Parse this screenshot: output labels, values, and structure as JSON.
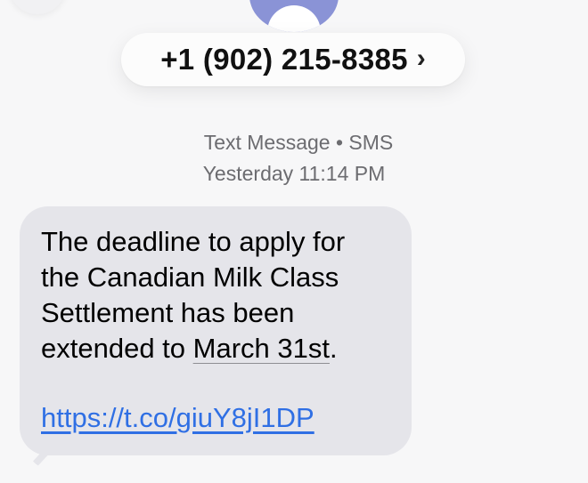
{
  "header": {
    "contact_name": "+1 (902) 215-8385",
    "chevron": "›"
  },
  "meta": {
    "channel": "Text Message • SMS",
    "timestamp": "Yesterday 11:14 PM"
  },
  "message": {
    "line1": "The deadline to apply for",
    "line2": "the Canadian Milk Class",
    "line3": "Settlement has been",
    "line4_prefix": "extended to ",
    "date_text": "March 31st",
    "line4_suffix": ".",
    "url": "https://t.co/giuY8jI1DP"
  },
  "colors": {
    "background": "#f7f7f8",
    "bubble": "#e5e5ea",
    "avatar": "#8a93d6",
    "link": "#2f6fe4",
    "meta_text": "#6c6c70"
  },
  "icons": {
    "back": "back-button-icon",
    "avatar": "person-silhouette-icon",
    "chevron": "chevron-right-icon"
  }
}
